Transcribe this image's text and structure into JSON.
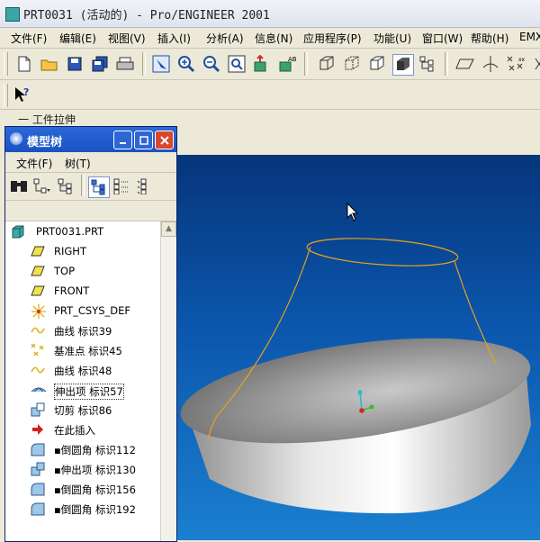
{
  "window": {
    "title": "PRT0031 (活动的) - Pro/ENGINEER 2001"
  },
  "menubar": [
    "文件(F)",
    "编辑(E)",
    "视图(V)",
    "插入(I)",
    "分析(A)",
    "信息(N)",
    "应用程序(P)",
    "功能(U)",
    "窗口(W)",
    "帮助(H)",
    "EMX"
  ],
  "status": {
    "message": "一 工件拉伸"
  },
  "model_tree": {
    "title": "模型树",
    "menu": [
      "文件(F)",
      "树(T)"
    ],
    "items": [
      {
        "label": "PRT0031.PRT",
        "icon": "part-icon"
      },
      {
        "label": "RIGHT",
        "icon": "datum-plane-icon"
      },
      {
        "label": "TOP",
        "icon": "datum-plane-icon"
      },
      {
        "label": "FRONT",
        "icon": "datum-plane-icon"
      },
      {
        "label": "PRT_CSYS_DEF",
        "icon": "csys-icon"
      },
      {
        "label": "曲线 标识39",
        "icon": "curve-icon"
      },
      {
        "label": "基准点 标识45",
        "icon": "datum-point-icon"
      },
      {
        "label": "曲线 标识48",
        "icon": "curve-icon"
      },
      {
        "label": "伸出项 标识57",
        "icon": "protrusion-icon"
      },
      {
        "label": "切剪 标识86",
        "icon": "cut-icon"
      },
      {
        "label": "在此插入",
        "icon": "insert-here-icon"
      },
      {
        "label": "▪倒圆角 标识112",
        "icon": "round-icon"
      },
      {
        "label": "▪伸出项 标识130",
        "icon": "protrusion-icon"
      },
      {
        "label": "▪倒圆角 标识156",
        "icon": "round-icon"
      },
      {
        "label": "▪倒圆角 标识192",
        "icon": "round-icon"
      }
    ]
  }
}
